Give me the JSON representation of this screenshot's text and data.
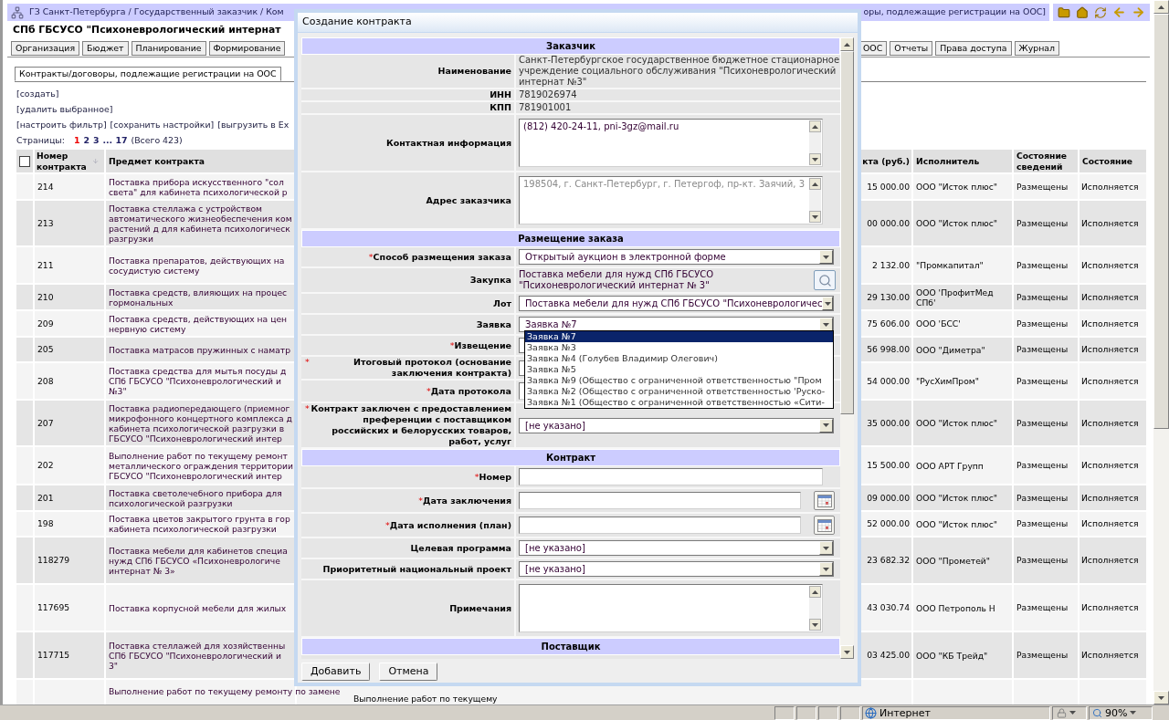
{
  "breadcrumb": {
    "left": "ГЗ Санкт-Петербурга / Государственный заказчик / Ком",
    "right": "оры, подлежащие регистрации на ООС]"
  },
  "org_title": "СПб ГБСУСО \"Психоневрологический интернат",
  "main_tabs_left": [
    {
      "label": "Организация",
      "selected": false
    },
    {
      "label": "Бюджет",
      "selected": false
    },
    {
      "label": "Планирование",
      "selected": false
    },
    {
      "label": "Формирование",
      "selected": false
    }
  ],
  "main_tabs_right": [
    {
      "label": "ООС",
      "selected": false
    },
    {
      "label": "Отчеты",
      "selected": false
    },
    {
      "label": "Права доступа",
      "selected": false
    },
    {
      "label": "Журнал",
      "selected": false
    }
  ],
  "sub_tabs": [
    {
      "label": "Контракты/договоры, подлежащие регистрации на ООС",
      "selected": true
    }
  ],
  "actions": [
    "[создать]",
    "[удалить выбранное]"
  ],
  "action_line": [
    "[настроить фильтр]",
    "[сохранить настройки]",
    "[выгрузить в Ex"
  ],
  "pager": {
    "label": "Страницы:",
    "pages": [
      {
        "label": "1",
        "selected": true
      },
      {
        "label": "2",
        "selected": false
      },
      {
        "label": "3",
        "selected": false
      }
    ],
    "last": "... 17",
    "total": "(Всего 423)"
  },
  "table": {
    "select_all": {
      "checked": false
    },
    "columns_left": [
      "Номер контракта",
      "Предмет контракта"
    ],
    "columns_right": [
      "кта (руб.)",
      "Исполнитель",
      "Состояние сведений",
      "Состояние"
    ],
    "rows": [
      {
        "number": "214",
        "subject": [
          "Поставка прибора искусственного \"сол",
          "света\" для кабинета психологической р"
        ],
        "price": "15 000.00",
        "executor": "ООО \"Исток плюс\"",
        "info_state": "Размещены",
        "state": "Исполняется"
      },
      {
        "number": "213",
        "subject": [
          "Поставка стеллажа с устройством",
          "автоматического жизнеобеспечения ком",
          "растений д для кабинета психологическ",
          "разгрузки"
        ],
        "price": "00 000.00",
        "executor": "ООО \"Исток плюс\"",
        "info_state": "Размещены",
        "state": "Исполняется"
      },
      {
        "number": "211",
        "subject": [
          "Поставка препаратов, действующих на",
          "сосудистую систему"
        ],
        "price": "2 132.00",
        "executor": "\"Промкапитал\"",
        "info_state": "Размещены",
        "state": "Исполняется"
      },
      {
        "number": "210",
        "subject": [
          "Поставка средств, влияющих на процес",
          "гормональных"
        ],
        "price": "29 130.00",
        "executor": "ООО 'ПрофитМед СПб'",
        "info_state": "Размещены",
        "state": "Исполняется"
      },
      {
        "number": "209",
        "subject": [
          "Поставка средств, действующих на цен",
          "нервную систему"
        ],
        "price": "75 606.00",
        "executor": "ООО 'БСС'",
        "info_state": "Размещены",
        "state": "Исполняется"
      },
      {
        "number": "205",
        "subject": [
          "Поставка матрасов пружинных с наматр"
        ],
        "price": "56 998.00",
        "executor": "ООО \"Диметра\"",
        "info_state": "Размещены",
        "state": "Исполняется"
      },
      {
        "number": "208",
        "subject": [
          "Поставка средства для мытья посуды д",
          "СПб ГБСУСО \"Психоневрологический и",
          "№3\""
        ],
        "price": "54 000.00",
        "executor": "\"РусХимПром\"",
        "info_state": "Размещены",
        "state": "Исполняется"
      },
      {
        "number": "207",
        "subject": [
          "Поставка радиопередающего (приемног",
          "микрофонного концертного комплекса д",
          "кабинета психологической разгрузки в",
          "ГБСУСО \"Психоневрологический интер"
        ],
        "price": "35 000.00",
        "executor": "ООО \"Исток плюс\"",
        "info_state": "Размещены",
        "state": "Исполняется"
      },
      {
        "number": "202",
        "subject": [
          "Выполнение работ по текущему ремонт",
          "металлического ограждения территории",
          "ГБСУСО \"Психоневрологический интер"
        ],
        "price": "15 500.00",
        "executor": "ООО АРТ Групп",
        "info_state": "Размещены",
        "state": "Исполняется"
      },
      {
        "number": "201",
        "subject": [
          "Поставка светолечебного прибора для",
          "психологической разгрузки"
        ],
        "price": "09 000.00",
        "executor": "ООО \"Исток плюс\"",
        "info_state": "Размещены",
        "state": "Исполняется"
      },
      {
        "number": "198",
        "subject": [
          "Поставка цветов закрытого грунта в гор",
          "кабинета психологической разгрузки"
        ],
        "price": "52 000.00",
        "executor": "ООО \"Исток плюс\"",
        "info_state": "Размещены",
        "state": "Исполняется"
      },
      {
        "number": "118279",
        "subject": [
          "Поставка мебели для кабинетов специа",
          "нужд СПб ГБСУСО «Психоневрологиче",
          "интернат № 3»"
        ],
        "price": "23 682.32",
        "executor": "ООО \"Прометей\"",
        "info_state": "Размещены",
        "state": "Исполняется"
      },
      {
        "number": "117695",
        "subject": [
          "Поставка корпусной мебели для жилых"
        ],
        "price": "43 030.74",
        "executor": "ООО Петрополь Н",
        "info_state": "Размещены",
        "state": "Исполняется"
      },
      {
        "number": "117715",
        "subject": [
          "Поставка стеллажей для хозяйственны",
          "СПб ГБСУСО \"Психоневрологический и",
          "3\""
        ],
        "price": "03 425.00",
        "executor": "ООО \"КБ Трейд\"",
        "info_state": "Размещены",
        "state": "Исполняется"
      },
      {
        "subject": [
          "Выполнение работ по текущему ремонту по замене"
        ],
        "column_3": "Выполнение работ по текущему"
      }
    ]
  },
  "modal": {
    "title": "Создание контракта",
    "sections": [
      {
        "title": "Заказчик",
        "fields": [
          {
            "kind": "text",
            "label": "Наименование",
            "value": "Санкт-Петербургское государственное бюджетное стационарное учреждение социального обслуживания \"Психоневрологический интернат №3\""
          },
          {
            "kind": "text",
            "label": "ИНН",
            "value": "7819026974"
          },
          {
            "kind": "text",
            "label": "КПП",
            "value": "781901001"
          },
          {
            "kind": "textarea",
            "label": "Контактная информация",
            "value": "(812) 420-24-11, pni-3gz@mail.ru",
            "disabled": false
          },
          {
            "kind": "textarea",
            "label": "Адрес заказчика",
            "value": "198504, г. Санкт-Петербург, г. Петергоф, пр-кт. Заячий, 3",
            "disabled": true
          }
        ]
      },
      {
        "title": "Размещение заказа",
        "fields": [
          {
            "kind": "select",
            "mark": "*",
            "label": "Способ размещения заказа",
            "value": "Открытый аукцион в электронной форме"
          },
          {
            "kind": "lookup",
            "label": "Закупка",
            "value": "Поставка мебели для нужд СПб ГБСУСО \"Психоневрологический интернат № 3\""
          },
          {
            "kind": "select",
            "label": "Лот",
            "value": "Поставка мебели для нужд СПб ГБСУСО \"Психоневрологичес"
          },
          {
            "kind": "select",
            "label": "Заявка",
            "value": "Заявка №7",
            "expanded": true,
            "options": [
              {
                "label": "Заявка №7",
                "selected": true
              },
              {
                "label": "Заявка №3",
                "selected": false
              },
              {
                "label": "Заявка №4 (Голубев  Владимир  Олегович)",
                "selected": false
              },
              {
                "label": "Заявка №5",
                "selected": false
              },
              {
                "label": "Заявка №9 (Общество с ограниченной ответственностью  \"Пром",
                "selected": false
              },
              {
                "label": "Заявка №2 (Общество с ограниченной ответственностью 'Руско-",
                "selected": false
              },
              {
                "label": "Заявка №1 (Общество с ограниченной ответственностью «Сити-",
                "selected": false
              }
            ]
          },
          {
            "kind": "select",
            "mark": "*",
            "label": "Извещение"
          },
          {
            "kind": "select",
            "mark": "*",
            "label": "Итоговый протокол (основание заключения контракта)"
          },
          {
            "kind": "input",
            "mark": "*",
            "label": "Дата протокола"
          },
          {
            "kind": "select",
            "mark": "*",
            "label": "Контракт заключен с предоставлением преференции с поставщиком российских и белорусских товаров, работ, услуг",
            "value": "[не указано]"
          }
        ]
      },
      {
        "title": "Контракт",
        "fields": [
          {
            "kind": "input",
            "mark": "*",
            "label": "Номер"
          },
          {
            "kind": "date",
            "mark": "*",
            "label": "Дата заключения"
          },
          {
            "kind": "date",
            "mark": "*",
            "label": "Дата исполнения (план)"
          },
          {
            "kind": "select",
            "label": "Целевая программа",
            "value": "[не указано]"
          },
          {
            "kind": "select",
            "label": "Приоритетный национальный проект",
            "value": "[не указано]"
          },
          {
            "kind": "textarea",
            "label": "Примечания"
          }
        ]
      },
      {
        "title": "Поставщик"
      }
    ],
    "buttons": [
      "Добавить",
      "Отмена"
    ]
  },
  "status_bar": {
    "zone": "Интернет",
    "zoom": "90%"
  }
}
